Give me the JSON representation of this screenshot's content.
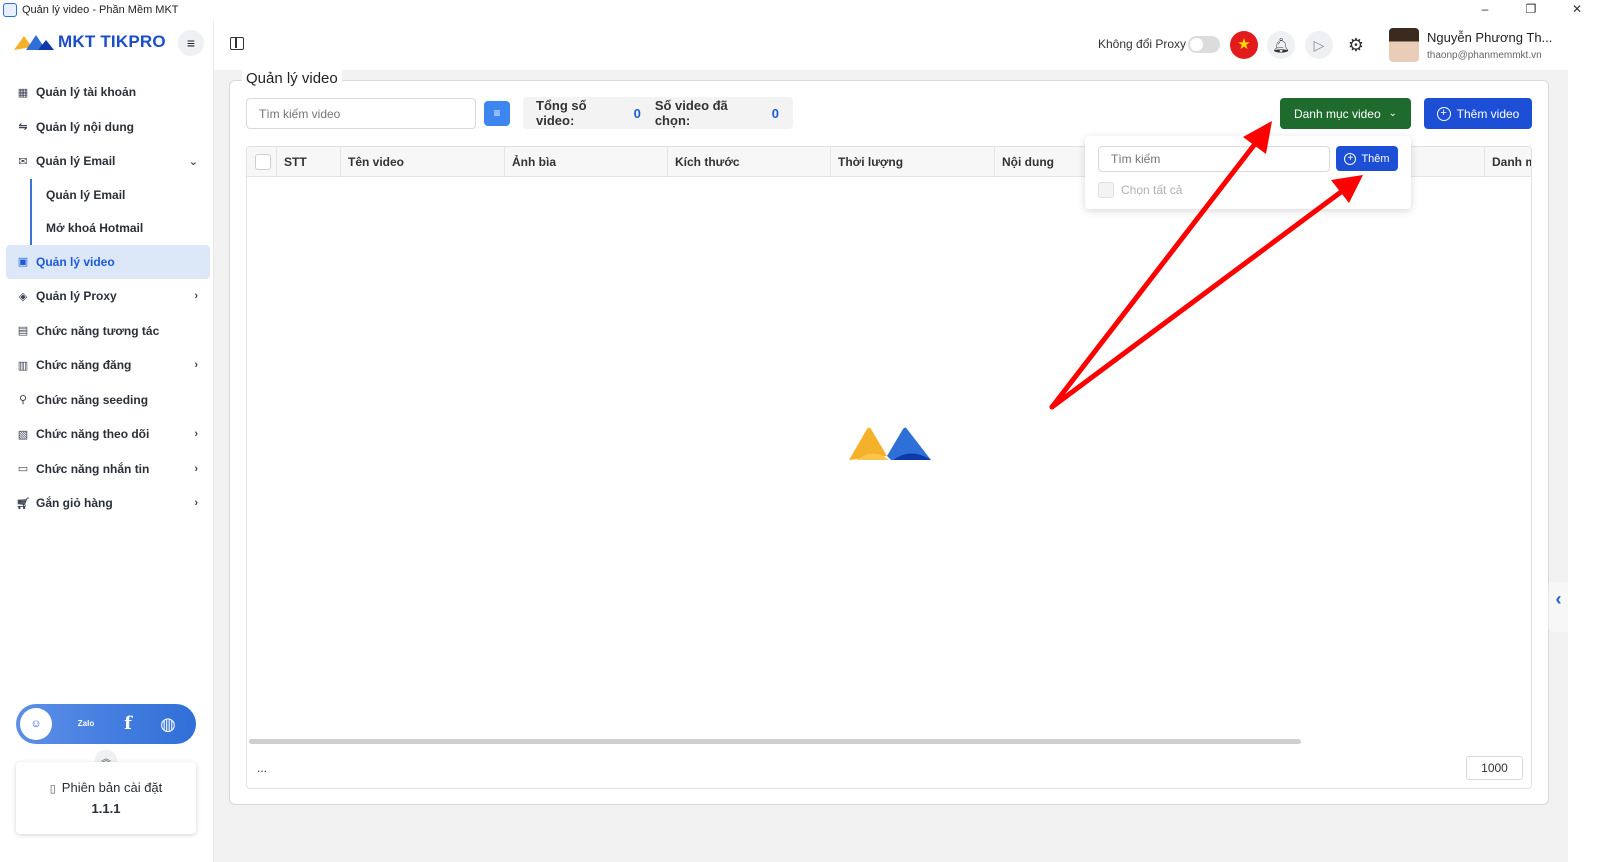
{
  "window": {
    "title": "Quản lý video - Phần Mềm MKT",
    "controls": [
      "–",
      "❐",
      "✕"
    ]
  },
  "brand": {
    "name": "MKT TIKPRO",
    "color": "#1a4ec8"
  },
  "sidebar": {
    "items": [
      {
        "label": "Quản lý tài khoản",
        "icon": "dashboard-icon"
      },
      {
        "label": "Quản lý nội dung",
        "icon": "content-icon"
      },
      {
        "label": "Quản lý Email",
        "icon": "email-icon",
        "expanded": true,
        "children": [
          {
            "label": "Quản lý Email"
          },
          {
            "label": "Mở khoá Hotmail"
          }
        ]
      },
      {
        "label": "Quản lý video",
        "icon": "video-icon",
        "active": true
      },
      {
        "label": "Quản lý Proxy",
        "icon": "proxy-icon"
      },
      {
        "label": "Chức năng tương tác",
        "icon": "interaction-icon"
      },
      {
        "label": "Chức năng đăng",
        "icon": "post-icon"
      },
      {
        "label": "Chức năng seeding",
        "icon": "seeding-icon"
      },
      {
        "label": "Chức năng theo dõi",
        "icon": "follow-icon"
      },
      {
        "label": "Chức năng nhắn tin",
        "icon": "message-icon"
      },
      {
        "label": "Gắn giỏ hàng",
        "icon": "cart-icon"
      }
    ],
    "social": [
      {
        "name": "support-icon",
        "glyph": "☺"
      },
      {
        "name": "zalo-icon",
        "glyph": "Zalo"
      },
      {
        "name": "facebook-icon",
        "glyph": "f"
      },
      {
        "name": "globe-icon",
        "glyph": "◍"
      }
    ],
    "version": {
      "label": "Phiên bản cài đặt",
      "number": "1.1.1"
    }
  },
  "header": {
    "proxy_label": "Không đổi Proxy",
    "proxy_enabled": false,
    "user": {
      "name": "Nguyễn Phương Th...",
      "email": "thaonp@phanmemmkt.vn"
    }
  },
  "page": {
    "title": "Quản lý video",
    "search_placeholder": "Tìm kiếm video",
    "stats": {
      "total_label": "Tổng số video:",
      "total": "0",
      "selected_label": "Số video đã chọn:",
      "selected": "0"
    },
    "category_button": "Danh mục video",
    "add_video_button": "Thêm video",
    "dropdown": {
      "search_placeholder": "Tìm kiếm",
      "add_button": "Thêm",
      "select_all": "Chọn tất cả"
    },
    "table": {
      "columns": [
        "STT",
        "Tên video",
        "Ảnh bìa",
        "Kích thước",
        "Thời lượng",
        "Nội dung",
        "Danh m"
      ],
      "rows": []
    },
    "footer": {
      "ellipsis": "...",
      "page_size": "1000"
    }
  },
  "colors": {
    "accent": "#1d4fd6",
    "category_green": "#1f6b2e",
    "active_bg": "#dce7f8",
    "annotation_red": "#ff0000"
  }
}
